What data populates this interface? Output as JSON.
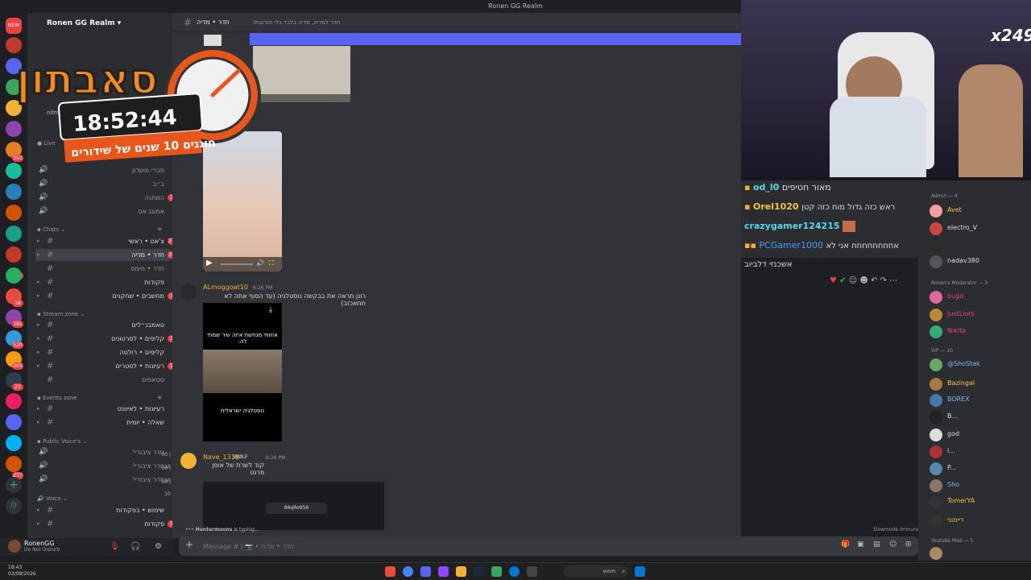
{
  "window": {
    "title": "Ronen GG Realm"
  },
  "server": {
    "name": "Ronen GG Realm",
    "partner_badge": "nitro"
  },
  "rail": {
    "new_badge": "NEW",
    "badges": [
      "352",
      "164",
      "18",
      "181",
      "520",
      "203",
      "21",
      "277"
    ]
  },
  "overlay_timer": {
    "title": "סאבתון",
    "time": "18:52:44",
    "subtitle": "חוגגים 10 שנים של שידורים"
  },
  "sidebar": {
    "live_label": "Live",
    "top_channels": [
      {
        "label": "חברי מועדון"
      },
      {
        "label": "ב״ב"
      },
      {
        "label": "המתנה",
        "badge": "3"
      },
      {
        "label": "אמונג אס"
      }
    ],
    "chats_category": "Chats",
    "chats": [
      {
        "label": "צ'אט • ראשי",
        "badge": "21"
      },
      {
        "label": "חדר • מדיה",
        "badge": "18",
        "active": true
      },
      {
        "label": "חדר • מימס"
      },
      {
        "label": "פקודות"
      },
      {
        "label": "מחשבים • שחקנים",
        "badge": "1"
      }
    ],
    "stream_category": "Stream zone",
    "stream": [
      {
        "label": "טאמבנ״לים"
      },
      {
        "label": "קליפים • לסרטונים",
        "badge": "2"
      },
      {
        "label": "קליפים • רולטה"
      },
      {
        "label": "רעיונות • לסטרים",
        "badge": "1"
      },
      {
        "label": "טטאפים"
      }
    ],
    "events_category": "Events zone",
    "events": [
      {
        "label": "רעיונות • לאיוונט"
      },
      {
        "label": "שאלה • יומית"
      }
    ],
    "public_voice_category": "Public Voice's",
    "public_voice": [
      {
        "label": "חדר ציבורי¹",
        "count": "00 | 10"
      },
      {
        "label": "חדר ציבורי²",
        "count": "00 | 10"
      },
      {
        "label": "חדר ציבורי³",
        "count": "00 | 10"
      }
    ],
    "voice_category": "Voice",
    "voice": [
      {
        "label": "שימוש • בפקודות"
      },
      {
        "label": "פקודות",
        "badge": "1"
      }
    ]
  },
  "user": {
    "name": "RonenGG",
    "status": "Do Not Disturb"
  },
  "chat_header": {
    "channel": "חדר • מדיה",
    "topic": "חדר למדיה, מדיה בלבד בלי הודעות!"
  },
  "messages": [
    {
      "author": "ALmoggoat10",
      "time": "6:26 PM",
      "text": "רונן תראה את בבקשה נוסטלגיה (עד הסוף אתה לא תתאכזב)",
      "caption_top": "אחותי מנחשת איזה שיר שמתי לה:",
      "caption_bottom": "נוסטלגיה ישראלית"
    },
    {
      "author": "Nave_1311",
      "tag": "WØLF",
      "time": "6:26 PM",
      "text": "קוד לשרת של אופן פרנט",
      "code": "86qRo956"
    }
  ],
  "typing": {
    "user": "Huntermoons",
    "suffix": "is typing..."
  },
  "slowmode": "Slowmode Immune",
  "composer": {
    "placeholder": "Message # | 📷 • חדר • מדיה"
  },
  "stream_chat": [
    {
      "name": "od_l0",
      "text": "מאור חטיפים",
      "color": "#5ad6e8"
    },
    {
      "name": "Orel1020",
      "text": "ראש כזה גדול מוח כזה קטן",
      "color": "#f5c542"
    },
    {
      "name": "crazygamer124215",
      "text": "",
      "color": "#5ad6e8"
    },
    {
      "name": "PCGamer1000",
      "text": "אחחחחחחחח אני לא אשכנזי דלביוב",
      "color": "#4a9df5"
    }
  ],
  "webcam": {
    "multiplier": "x249"
  },
  "members": {
    "admin_header": "Admin — 4",
    "admins": [
      {
        "name": "Avet",
        "color": "#f5c542"
      },
      {
        "name": "electro_V",
        "color": "#dbdee1"
      },
      {
        "name": "nadav380",
        "color": "#dbdee1"
      }
    ],
    "mod_header": "Ronen's Moderator — 3",
    "mods": [
      {
        "name": "bugo",
        "color": "#f23f8a"
      },
      {
        "name": "JustLiors",
        "color": "#f23f8a"
      },
      {
        "name": "Nikita",
        "color": "#f23f8a"
      }
    ],
    "vip_header": "VIP — 10",
    "vips": [
      {
        "name": "@ShoStak",
        "color": "#7fb7ff"
      },
      {
        "name": "Bazingal",
        "color": "#f5c542"
      },
      {
        "name": "BOREX",
        "color": "#7fb7ff"
      },
      {
        "name": "B...",
        "color": "#dbdee1"
      },
      {
        "name": "god",
        "color": "#dbdee1"
      },
      {
        "name": "i...",
        "color": "#dbdee1"
      },
      {
        "name": "P...",
        "color": "#dbdee1"
      },
      {
        "name": "Sho",
        "color": "#7fb7ff"
      },
      {
        "name": "TomerYA",
        "color": "#f5c542"
      },
      {
        "name": "דיימוני",
        "color": "#f5c542"
      }
    ],
    "yt_header": "Youtube Mod — 5"
  },
  "taskbar": {
    "time": "18:43",
    "date": "03/08/2026",
    "search": "חיפוש"
  }
}
